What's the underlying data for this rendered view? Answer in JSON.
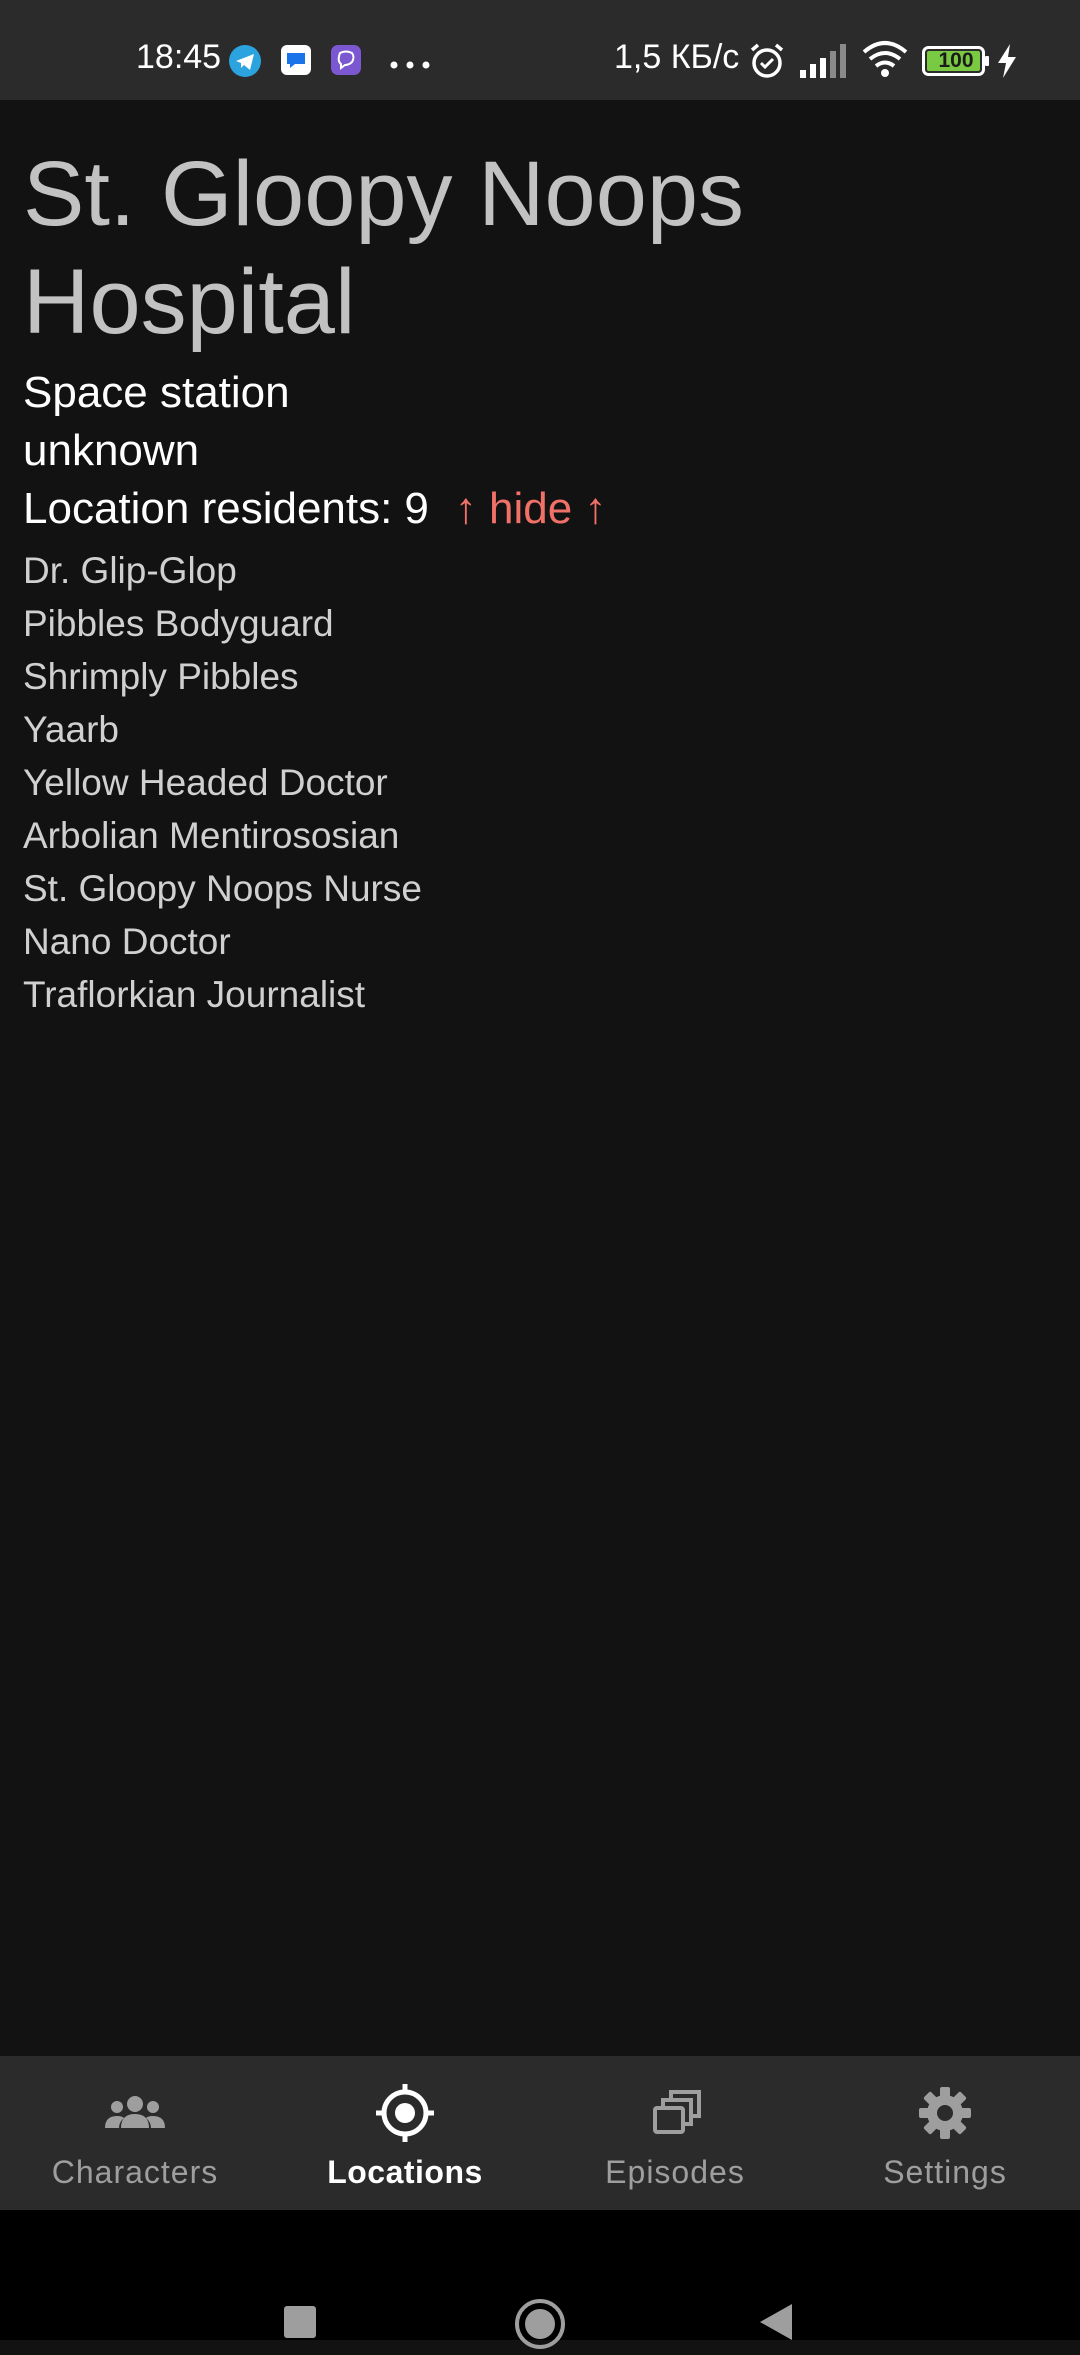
{
  "status_bar": {
    "time": "18:45",
    "net_speed": "1,5 КБ/с",
    "battery": "100",
    "notification_icons": [
      "telegram-icon",
      "messages-icon",
      "viber-icon",
      "more-dots-icon"
    ],
    "system_icons": [
      "alarm-icon",
      "signal-icon",
      "wifi-icon",
      "battery-icon",
      "charging-icon"
    ]
  },
  "location": {
    "name": "St. Gloopy Noops Hospital",
    "type": "Space station",
    "dimension": "unknown",
    "residents_label": "Location residents:",
    "residents_count": "9",
    "hide_label": "↑ hide ↑",
    "residents": [
      "Dr. Glip-Glop",
      "Pibbles Bodyguard",
      "Shrimply Pibbles",
      "Yaarb",
      "Yellow Headed Doctor",
      "Arbolian Mentirososian",
      "St. Gloopy Noops Nurse",
      "Nano Doctor",
      "Traflorkian Journalist"
    ]
  },
  "bottom_nav": {
    "items": [
      {
        "label": "Characters",
        "icon": "people-icon",
        "active": false
      },
      {
        "label": "Locations",
        "icon": "location-target-icon",
        "active": true
      },
      {
        "label": "Episodes",
        "icon": "library-icon",
        "active": false
      },
      {
        "label": "Settings",
        "icon": "gear-icon",
        "active": false
      }
    ]
  },
  "system_nav": {
    "buttons": [
      "recents-square-icon",
      "home-circle-icon",
      "back-triangle-icon"
    ]
  },
  "colors": {
    "background": "#121212",
    "bars": "#2b2b2b",
    "accent": "#f07167",
    "title": "#c2c2c2",
    "battery_green": "#7ac943"
  }
}
